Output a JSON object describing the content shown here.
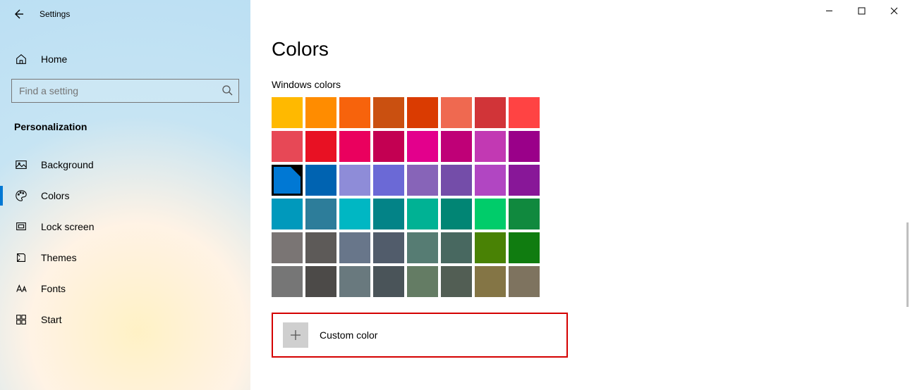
{
  "window": {
    "title": "Settings"
  },
  "sidebar": {
    "home_label": "Home",
    "search_placeholder": "Find a setting",
    "category_label": "Personalization",
    "items": [
      {
        "label": "Background"
      },
      {
        "label": "Colors"
      },
      {
        "label": "Lock screen"
      },
      {
        "label": "Themes"
      },
      {
        "label": "Fonts"
      },
      {
        "label": "Start"
      }
    ]
  },
  "main": {
    "title": "Colors",
    "section_label": "Windows colors",
    "custom_label": "Custom color",
    "selected_index": 16,
    "swatches": [
      "#ffb900",
      "#ff8c00",
      "#f7630c",
      "#ca5010",
      "#da3b01",
      "#ef6950",
      "#d13438",
      "#ff4343",
      "#e74856",
      "#e81123",
      "#ea005e",
      "#c30052",
      "#e3008c",
      "#bf0077",
      "#c239b3",
      "#9a0089",
      "#0078d4",
      "#0063b1",
      "#8e8cd8",
      "#6b69d6",
      "#8764b8",
      "#744da9",
      "#b146c2",
      "#881798",
      "#0099bc",
      "#2d7d9a",
      "#00b7c3",
      "#038387",
      "#00b294",
      "#018574",
      "#00cc6a",
      "#10893e",
      "#7a7574",
      "#5d5a58",
      "#68768a",
      "#515c6b",
      "#567c73",
      "#486860",
      "#498205",
      "#107c10",
      "#767676",
      "#4c4a48",
      "#69797e",
      "#4a5459",
      "#647c64",
      "#525e54",
      "#847545",
      "#7e735f"
    ]
  }
}
